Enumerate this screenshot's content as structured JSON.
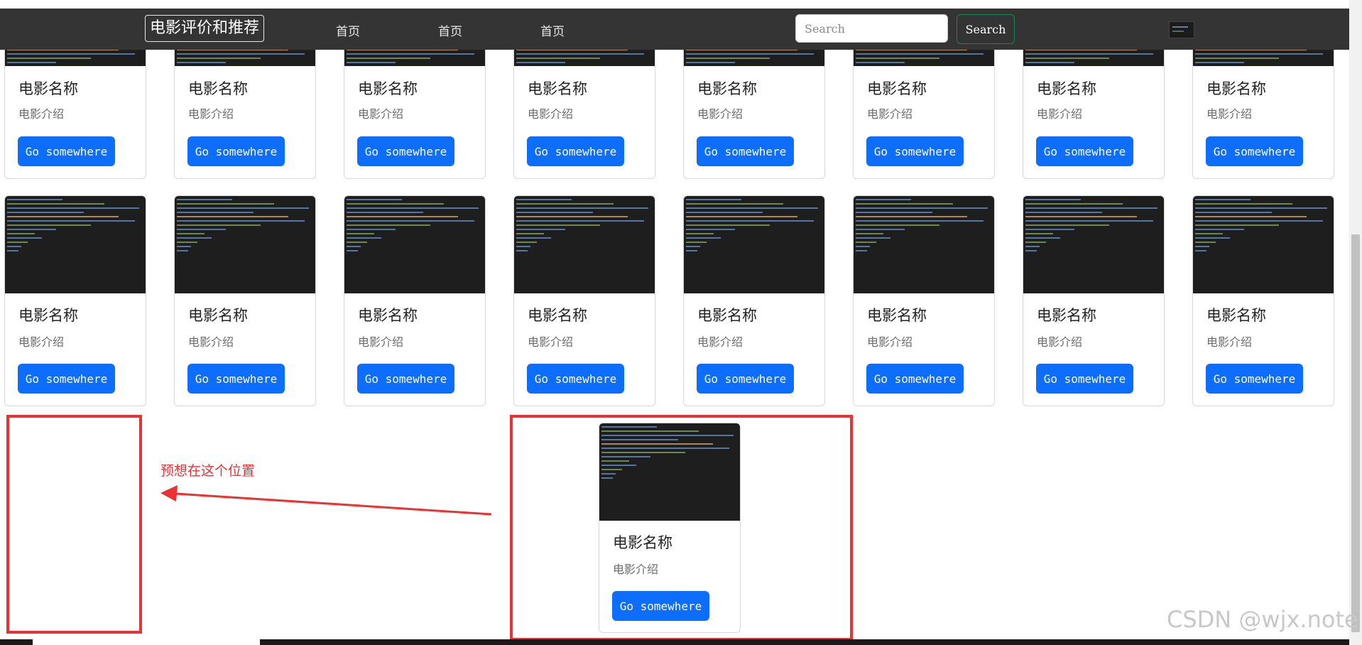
{
  "navbar": {
    "brand": "电影评价和推荐",
    "links": [
      "首页",
      "首页",
      "首页"
    ],
    "search_placeholder": "Search",
    "search_button": "Search"
  },
  "card": {
    "title": "电影名称",
    "description": "电影介绍",
    "button": "Go somewhere"
  },
  "annotation": {
    "text": "预想在这个位置"
  },
  "watermark": "CSDN @wjx.note",
  "colors": {
    "navbar_bg": "#343434",
    "primary_button": "#0d6efd",
    "success_outline": "#198754",
    "annotation_red": "#ea3232"
  }
}
